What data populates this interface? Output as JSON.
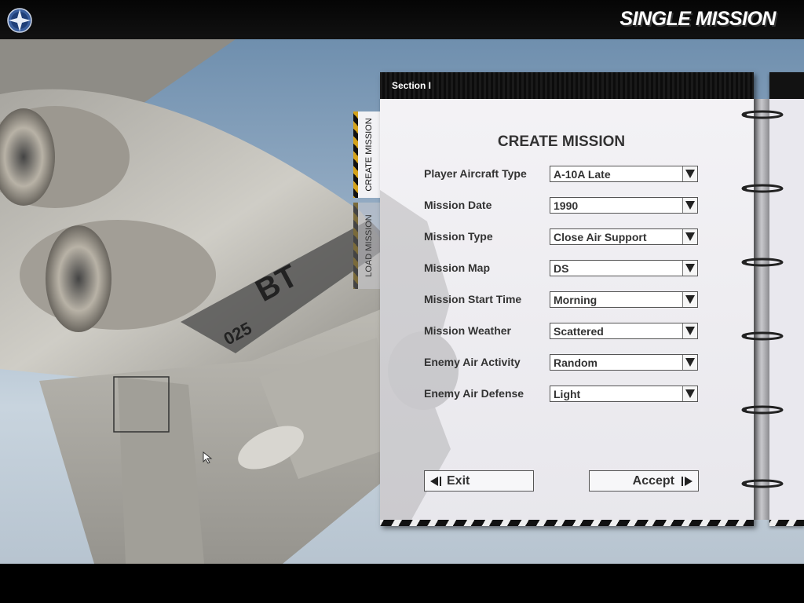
{
  "header": {
    "title": "SINGLE MISSION"
  },
  "tabs": [
    {
      "label": "CREATE MISSION",
      "active": true
    },
    {
      "label": "LOAD MISSION",
      "active": false
    }
  ],
  "notebook": {
    "section_label": "Section I",
    "form_title": "CREATE MISSION"
  },
  "form": {
    "rows": [
      {
        "label": "Player Aircraft Type",
        "value": "A-10A Late"
      },
      {
        "label": "Mission Date",
        "value": "1990"
      },
      {
        "label": "Mission Type",
        "value": "Close Air Support"
      },
      {
        "label": "Mission Map",
        "value": "DS"
      },
      {
        "label": "Mission Start Time",
        "value": "Morning"
      },
      {
        "label": "Mission Weather",
        "value": "Scattered"
      },
      {
        "label": "Enemy Air Activity",
        "value": "Random"
      },
      {
        "label": "Enemy Air Defense",
        "value": "Light"
      }
    ]
  },
  "buttons": {
    "exit": "Exit",
    "accept": "Accept"
  },
  "scene": {
    "aircraft_markings": [
      "BT",
      "025"
    ]
  },
  "colors": {
    "hazard_yellow": "#d4a21a",
    "panel": "#f4f3f6",
    "sky": "#9cb2c8"
  }
}
